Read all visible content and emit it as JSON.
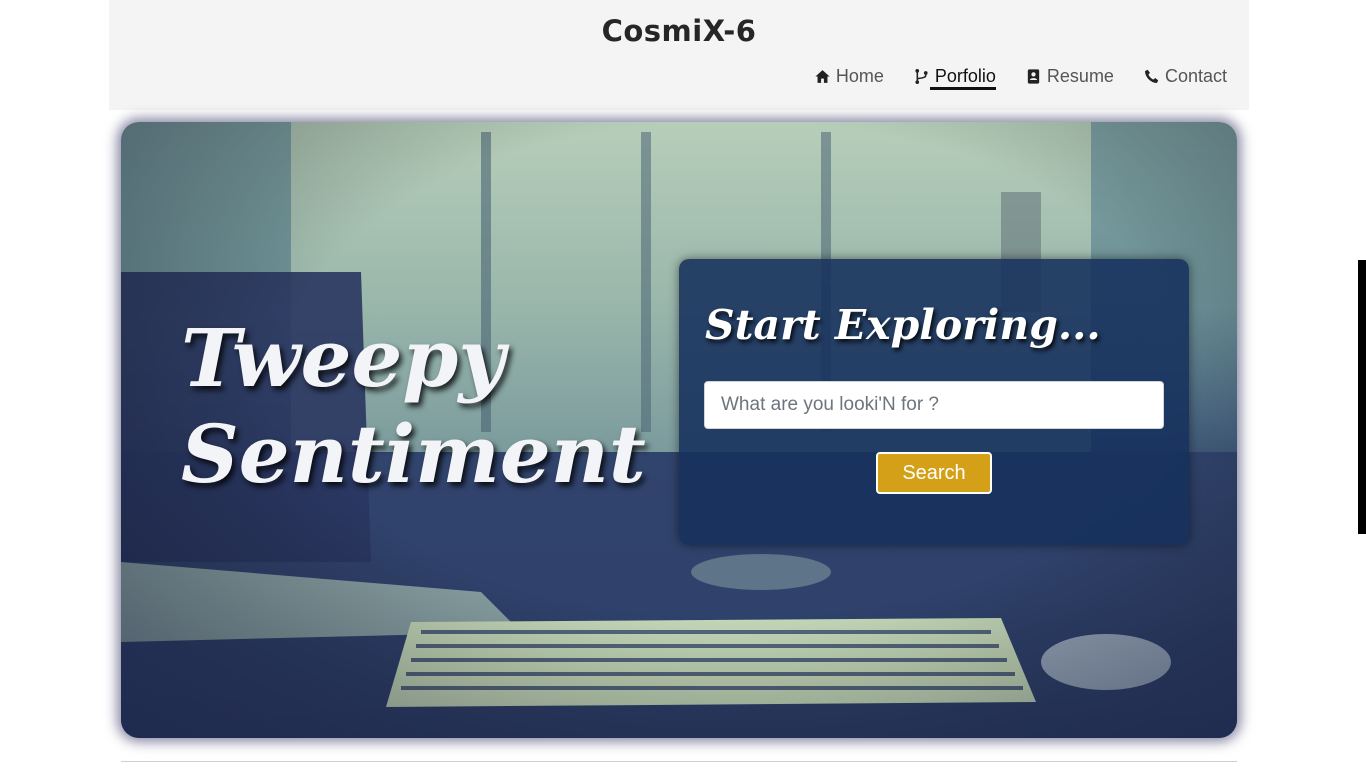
{
  "header": {
    "brand": "CosmiX-6",
    "nav": [
      {
        "label": "Home",
        "icon": "home-icon",
        "active": false
      },
      {
        "label": "Porfolio",
        "icon": "code-branch-icon",
        "active": true
      },
      {
        "label": "Resume",
        "icon": "id-card-icon",
        "active": false
      },
      {
        "label": "Contact",
        "icon": "phone-icon",
        "active": false
      }
    ]
  },
  "hero": {
    "title_line1": "Tweepy",
    "title_line2": "Sentiment",
    "panel": {
      "title": "Start Exploring...",
      "search_placeholder": "What are you looki'N for ?",
      "search_value": "",
      "search_button": "Search"
    }
  },
  "colors": {
    "header_bg": "#f4f4f4",
    "panel_bg": "#16305c",
    "button_bg": "#d4a017",
    "title_text": "#f3f4f8"
  }
}
